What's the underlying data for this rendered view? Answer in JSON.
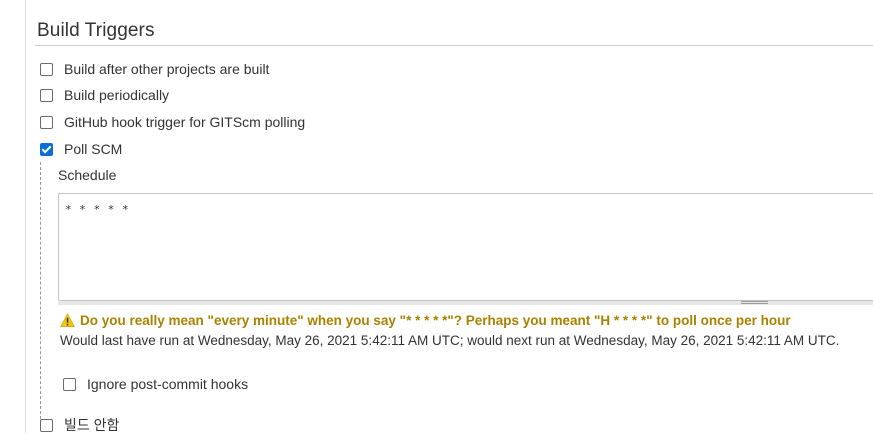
{
  "section": {
    "title": "Build Triggers"
  },
  "triggers": [
    {
      "label": "Build after other projects are built",
      "checked": false
    },
    {
      "label": "Build periodically",
      "checked": false
    },
    {
      "label": "GitHub hook trigger for GITScm polling",
      "checked": false
    },
    {
      "label": "Poll SCM",
      "checked": true
    }
  ],
  "poll_scm": {
    "schedule_label": "Schedule",
    "schedule_value": "* * * * *",
    "warning": "Do you really mean \"every minute\" when you say \"* * * * *\"? Perhaps you meant \"H * * * *\" to poll once per hour",
    "info": "Would last have run at Wednesday, May 26, 2021 5:42:11 AM UTC; would next run at Wednesday, May 26, 2021 5:42:11 AM UTC.",
    "ignore_label": "Ignore post-commit hooks",
    "ignore_checked": false
  },
  "quiet": {
    "label": "빌드 안함",
    "checked": false
  },
  "colors": {
    "accent": "#0a6fd8",
    "warning": "#a88200",
    "warning_icon": "#f1c40f"
  }
}
